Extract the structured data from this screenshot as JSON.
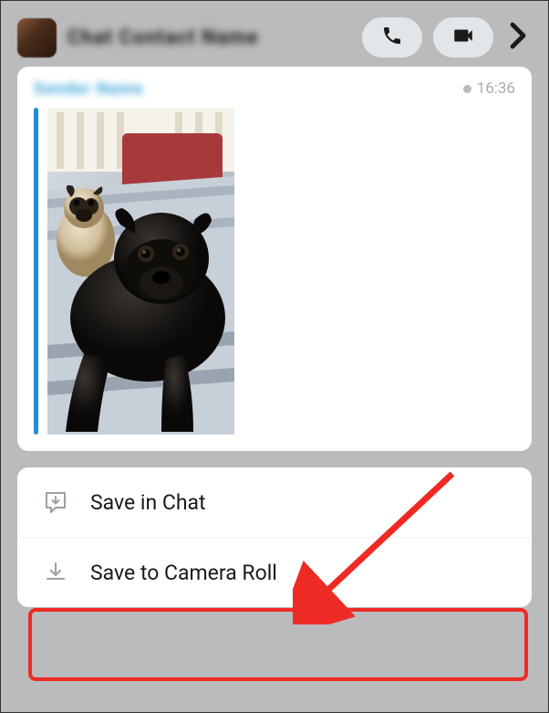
{
  "header": {
    "title": "Chat Contact Name",
    "icons": {
      "call": "phone-icon",
      "video": "video-icon",
      "forward": "chevron-right-icon"
    }
  },
  "chat": {
    "sender": "Sender Name",
    "timestamp": "16:36"
  },
  "menu": {
    "saveInChat": "Save in Chat",
    "saveToCameraRoll": "Save to Camera Roll"
  }
}
